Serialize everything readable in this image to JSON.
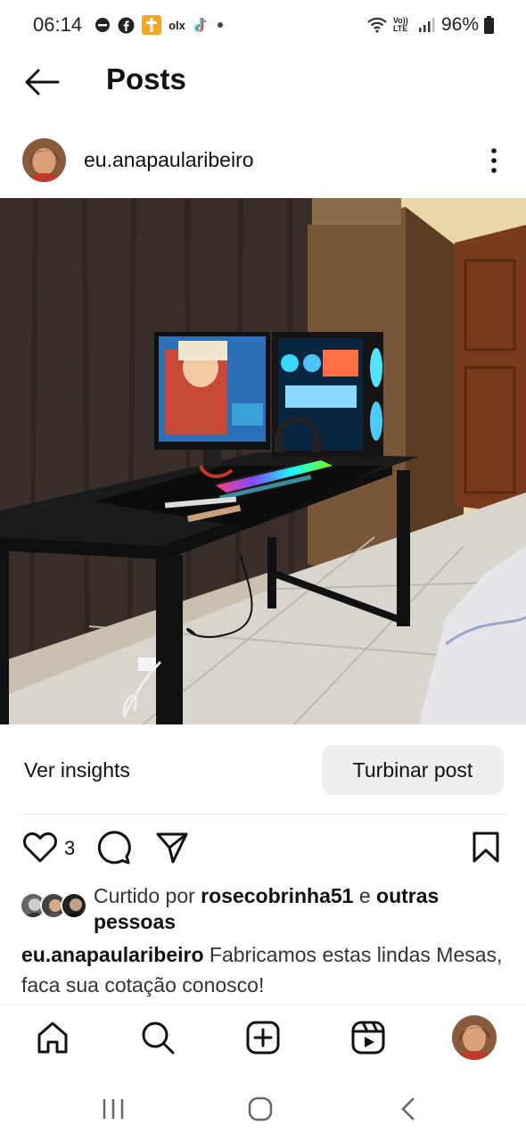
{
  "status_bar": {
    "time": "06:14",
    "app_icons": [
      "do-not-disturb-icon",
      "facebook-icon",
      "bible-app-icon",
      "olx-icon",
      "tiktok-icon",
      "dot-icon"
    ],
    "olx_label": "olx",
    "network_label": "Vo)) LTE",
    "battery": "96%"
  },
  "header": {
    "title": "Posts"
  },
  "post": {
    "username": "eu.anapaularibeiro",
    "image_alt": "Mesa gamer preta com monitor, PC gamer RGB, teclado e headset",
    "insights_label": "Ver insights",
    "boost_label": "Turbinar post",
    "like_count": "3",
    "likes": {
      "prefix": "Curtido por ",
      "user": "rosecobrinha51",
      "connector": " e ",
      "suffix": "outras pessoas"
    },
    "caption": {
      "author": "eu.anapaularibeiro",
      "text": " Fabricamos estas lindas Mesas, faca sua cotação conosco!"
    }
  },
  "bottom_nav": {
    "items": [
      "home-icon",
      "search-icon",
      "create-icon",
      "reels-icon",
      "profile-avatar"
    ]
  },
  "system_nav": {
    "items": [
      "recents-icon",
      "home-button-icon",
      "back-icon"
    ]
  },
  "colors": {
    "text": "#111111",
    "secondary_text": "#333333",
    "boost_bg": "#efeff1"
  }
}
